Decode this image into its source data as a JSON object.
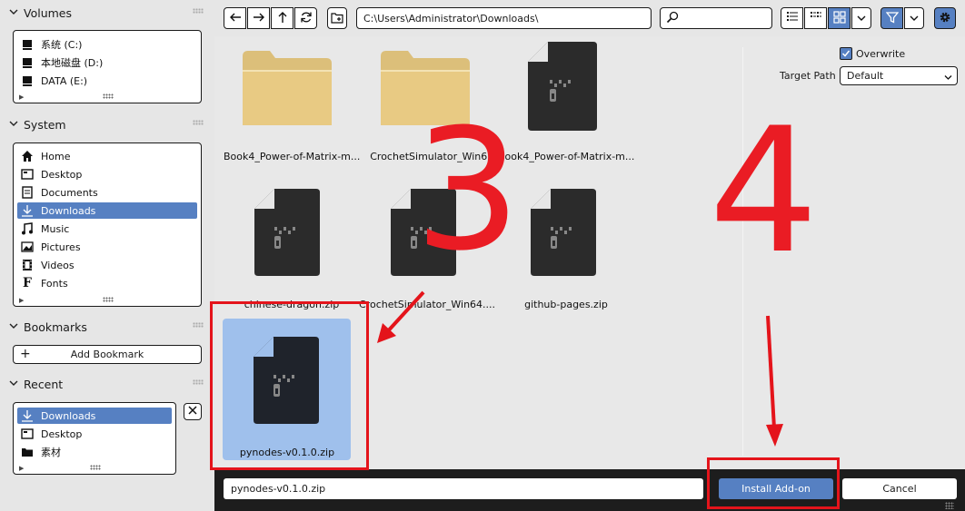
{
  "sidebar": {
    "volumes": {
      "title": "Volumes",
      "items": [
        {
          "label": "系统 (C:)",
          "icon": "disk-icon"
        },
        {
          "label": "本地磁盘 (D:)",
          "icon": "disk-icon"
        },
        {
          "label": "DATA (E:)",
          "icon": "disk-icon"
        }
      ]
    },
    "system": {
      "title": "System",
      "items": [
        {
          "label": "Home",
          "icon": "home-icon"
        },
        {
          "label": "Desktop",
          "icon": "desktop-icon"
        },
        {
          "label": "Documents",
          "icon": "documents-icon"
        },
        {
          "label": "Downloads",
          "icon": "download-icon",
          "selected": true
        },
        {
          "label": "Music",
          "icon": "music-icon"
        },
        {
          "label": "Pictures",
          "icon": "pictures-icon"
        },
        {
          "label": "Videos",
          "icon": "videos-icon"
        },
        {
          "label": "Fonts",
          "icon": "fonts-icon"
        }
      ]
    },
    "bookmarks": {
      "title": "Bookmarks",
      "add_label": "Add Bookmark"
    },
    "recent": {
      "title": "Recent",
      "items": [
        {
          "label": "Downloads",
          "icon": "download-icon",
          "selected": true
        },
        {
          "label": "Desktop",
          "icon": "desktop-icon"
        },
        {
          "label": "素材",
          "icon": "folder-icon"
        }
      ]
    }
  },
  "toolbar": {
    "path": "C:\\Users\\Administrator\\Downloads\\",
    "search_placeholder": ""
  },
  "files": [
    {
      "name": "Book4_Power-of-Matrix-m...",
      "type": "folder"
    },
    {
      "name": "CrochetSimulator_Win6...",
      "type": "folder"
    },
    {
      "name": "Book4_Power-of-Matrix-m...",
      "type": "zip"
    },
    {
      "name": "chinese-dragon.zip",
      "type": "zip"
    },
    {
      "name": "CrochetSimulator_Win64....",
      "type": "zip"
    },
    {
      "name": "github-pages.zip",
      "type": "zip"
    },
    {
      "name": "pynodes-v0.1.0.zip",
      "type": "zip",
      "selected": true
    }
  ],
  "options": {
    "overwrite_label": "Overwrite",
    "overwrite_checked": true,
    "target_path_label": "Target Path",
    "target_path_value": "Default"
  },
  "bottom": {
    "filename": "pynodes-v0.1.0.zip",
    "install_label": "Install Add-on",
    "cancel_label": "Cancel"
  },
  "annotations": {
    "step_a": "3",
    "step_b": "4",
    "color": "#e4141b"
  },
  "colors": {
    "accent": "#5680c2",
    "selected_file": "#9fc0ec",
    "panel": "#e6e6e6"
  }
}
